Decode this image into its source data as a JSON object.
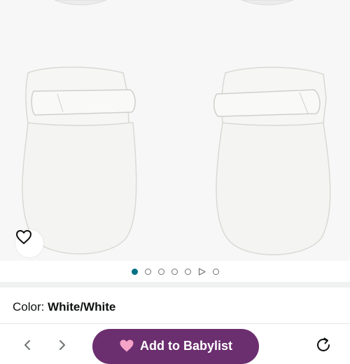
{
  "product": {
    "image_alt_icon": "baby-mittens-image",
    "wishlist_icon": "heart-outline-icon"
  },
  "carousel": {
    "dots": [
      "dot",
      "dot",
      "dot",
      "dot",
      "dot",
      "play",
      "dot"
    ],
    "active_index": 0,
    "active_color": "#007185"
  },
  "variation": {
    "label": "Color:",
    "value": "White/White"
  },
  "bottom_bar": {
    "prev_icon": "chevron-left-icon",
    "next_icon": "chevron-right-icon",
    "babylist_button_label": "Add to Babylist",
    "babylist_button_color": "#6b2e6f",
    "babylist_heart_color": "#f5a3c7",
    "refresh_icon": "refresh-icon"
  }
}
